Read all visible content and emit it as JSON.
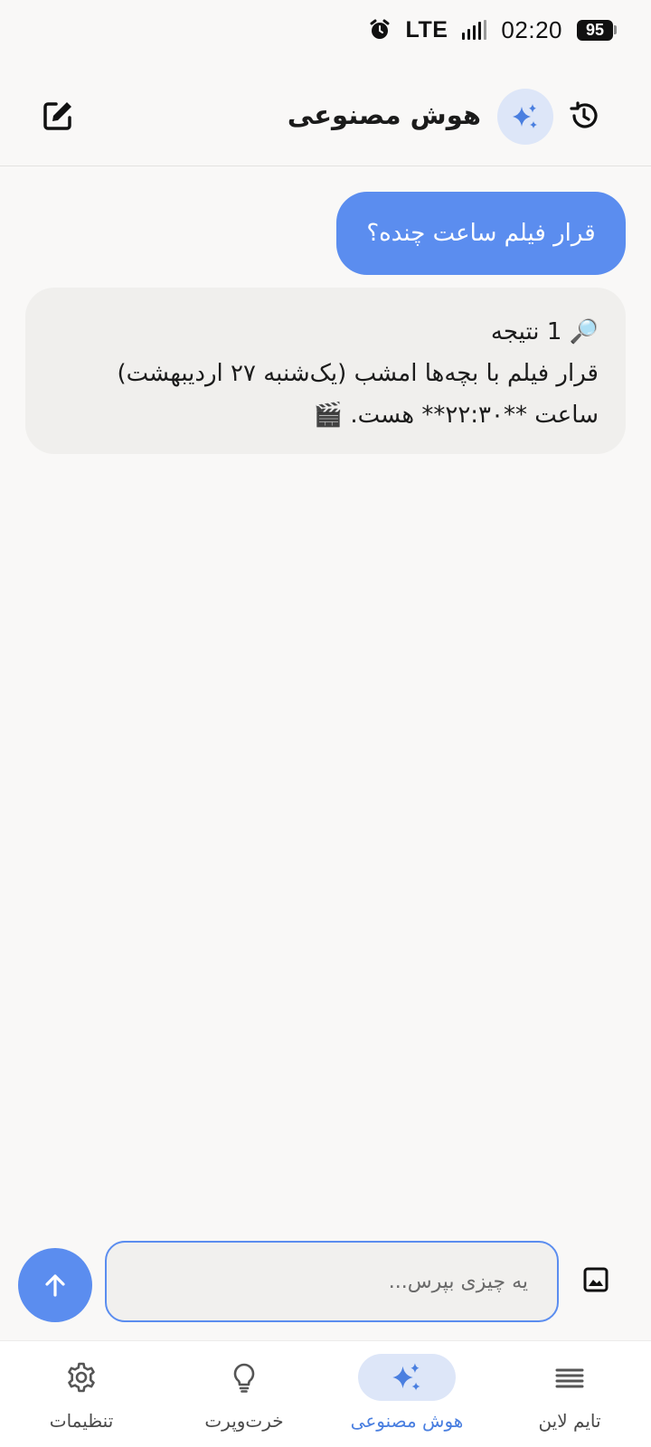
{
  "status_bar": {
    "network": "LTE",
    "time": "02:20",
    "battery": "95"
  },
  "header": {
    "title": "هوش مصنوعی"
  },
  "messages": {
    "user": "قرار فیلم ساعت چنده؟",
    "ai_line1": "🔎 1 نتیجه",
    "ai_line2": "قرار فیلم با بچه‌ها امشب (یک‌شنبه ۲۷ اردیبهشت)",
    "ai_line3": "ساعت **۲۲:۳۰** هست. 🎬"
  },
  "composer": {
    "placeholder": "یه چیزی بپرس..."
  },
  "nav": {
    "timeline": "تایم لاین",
    "ai": "هوش مصنوعی",
    "misc": "خرت‌وپرت",
    "settings": "تنظیمات"
  },
  "colors": {
    "accent": "#5b8def",
    "accent_soft": "#dde6f8",
    "background": "#f9f8f7",
    "ai_bubble": "#f0efed"
  }
}
